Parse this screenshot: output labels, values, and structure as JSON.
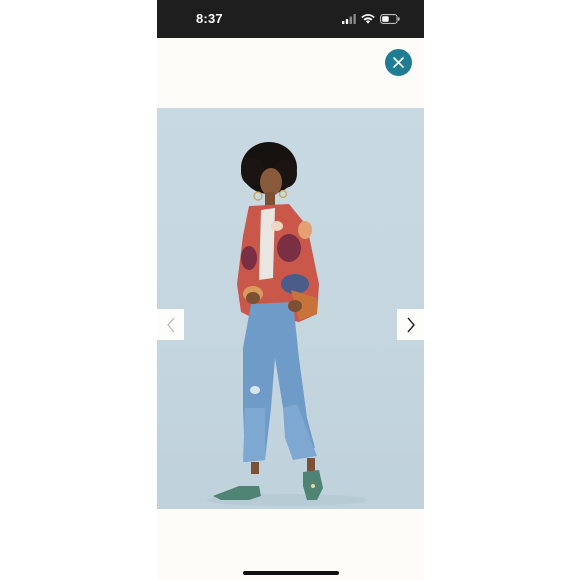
{
  "status_bar": {
    "time": "8:37",
    "icons": [
      "signal-icon",
      "wifi-icon",
      "battery-icon"
    ]
  },
  "overlay": {
    "close_icon": "close-icon",
    "accent_color": "#1f7d93"
  },
  "gallery": {
    "prev_icon": "chevron-left-icon",
    "next_icon": "chevron-right-icon",
    "image_subject": "product-photo"
  },
  "colors": {
    "status_bar_bg": "#1e1e1e",
    "page_bg": "#fdfcf8",
    "photo_bg": "#c6d7e0"
  }
}
